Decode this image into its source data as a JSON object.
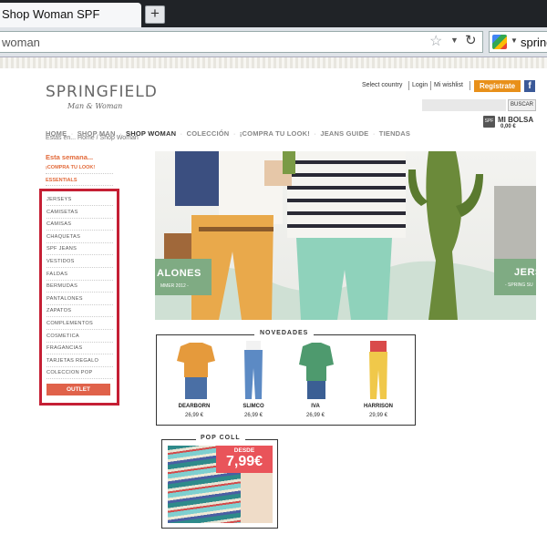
{
  "browser": {
    "tab_title": "Shop Woman SPF",
    "new_tab": "+",
    "url": "woman",
    "search_text": "spring"
  },
  "site": {
    "logo": "SPRINGFIELD",
    "tagline": "Man & Woman",
    "top_links": [
      "Select country",
      "Login",
      "Mi wishlist"
    ],
    "register_label": "Regístrate",
    "facebook": "f",
    "search_button": "BUSCAR",
    "bag_icon": "SPF",
    "bag_label": "MI BOLSA",
    "bag_total": "0,00 €",
    "nav": [
      "HOME",
      "SHOP MAN",
      "SHOP WOMAN",
      "COLECCIÓN",
      "¡COMPRA TU LOOK!",
      "JEANS GUIDE",
      "TIENDAS"
    ],
    "nav_sep": "·",
    "breadcrumb": "Estás en... Home / Shop Woman"
  },
  "sidebar": {
    "this_week": "Esta semana...",
    "compra_look": "¡COMPRA TU LOOK!",
    "essentials": "ESSENTIALS",
    "items": [
      "JERSEYS",
      "CAMISETAS",
      "CAMISAS",
      "CHAQUETAS",
      "SPF JEANS",
      "VESTIDOS",
      "FALDAS",
      "BERMUDAS",
      "PANTALONES",
      "ZAPATOS",
      "COMPLEMENTOS",
      "COSMETICA",
      "FRAGANCIAS",
      "TARJETAS REGALO",
      "COLECCION POP"
    ],
    "outlet": "OUTLET"
  },
  "banner": {
    "left_title": "ALONES",
    "left_sub": "MMER 2012 -",
    "right_title": "JERS",
    "right_sub": "- SPRING SU"
  },
  "novedades": {
    "title": "NOVEDADES",
    "products": [
      {
        "name": "DEARBORN",
        "price": "26,99 €"
      },
      {
        "name": "SLIMCO",
        "price": "26,99 €"
      },
      {
        "name": "IVA",
        "price": "26,99 €"
      },
      {
        "name": "HARRISON",
        "price": "29,99 €"
      }
    ]
  },
  "popcoll": {
    "title": "POP COLL",
    "desde": "DESDE",
    "price": "7,99€"
  }
}
